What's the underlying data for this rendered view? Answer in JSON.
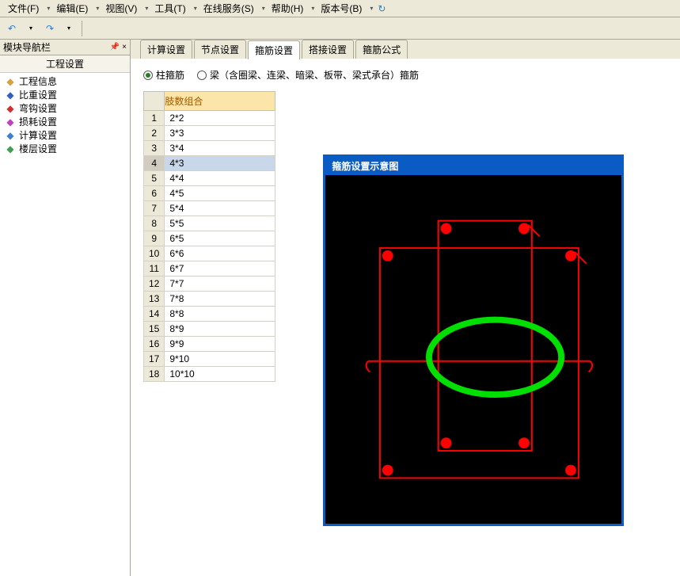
{
  "menubar": {
    "items": [
      "文件(F)",
      "编辑(E)",
      "视图(V)",
      "工具(T)",
      "在线服务(S)",
      "帮助(H)",
      "版本号(B)"
    ]
  },
  "left_panel": {
    "header": "模块导航栏",
    "subheader": "工程设置",
    "items": [
      {
        "icon": "folder-icon",
        "label": "工程信息",
        "color": "#d4a040"
      },
      {
        "icon": "weight-icon",
        "label": "比重设置",
        "color": "#3060c0"
      },
      {
        "icon": "bend-icon",
        "label": "弯钩设置",
        "color": "#d03030"
      },
      {
        "icon": "loss-icon",
        "label": "损耗设置",
        "color": "#c040c0"
      },
      {
        "icon": "calc-icon",
        "label": "计算设置",
        "color": "#4080d0"
      },
      {
        "icon": "floor-icon",
        "label": "楼层设置",
        "color": "#40a050"
      }
    ]
  },
  "tabs": {
    "items": [
      "计算设置",
      "节点设置",
      "箍筋设置",
      "搭接设置",
      "箍筋公式"
    ],
    "active_index": 2
  },
  "radios": {
    "option1": "柱箍筋",
    "option2": "梁（含圈梁、连梁、暗梁、板带、梁式承台）箍筋",
    "selected": 0
  },
  "table": {
    "header": "肢数组合",
    "rows": [
      {
        "num": "1",
        "val": "2*2"
      },
      {
        "num": "2",
        "val": "3*3"
      },
      {
        "num": "3",
        "val": "3*4"
      },
      {
        "num": "4",
        "val": "4*3"
      },
      {
        "num": "5",
        "val": "4*4"
      },
      {
        "num": "6",
        "val": "4*5"
      },
      {
        "num": "7",
        "val": "5*4"
      },
      {
        "num": "8",
        "val": "5*5"
      },
      {
        "num": "9",
        "val": "6*5"
      },
      {
        "num": "10",
        "val": "6*6"
      },
      {
        "num": "11",
        "val": "6*7"
      },
      {
        "num": "12",
        "val": "7*7"
      },
      {
        "num": "13",
        "val": "7*8"
      },
      {
        "num": "14",
        "val": "8*8"
      },
      {
        "num": "15",
        "val": "8*9"
      },
      {
        "num": "16",
        "val": "9*9"
      },
      {
        "num": "17",
        "val": "9*10"
      },
      {
        "num": "18",
        "val": "10*10"
      }
    ],
    "selected_index": 3
  },
  "diagram": {
    "title": "箍筋设置示意图"
  }
}
